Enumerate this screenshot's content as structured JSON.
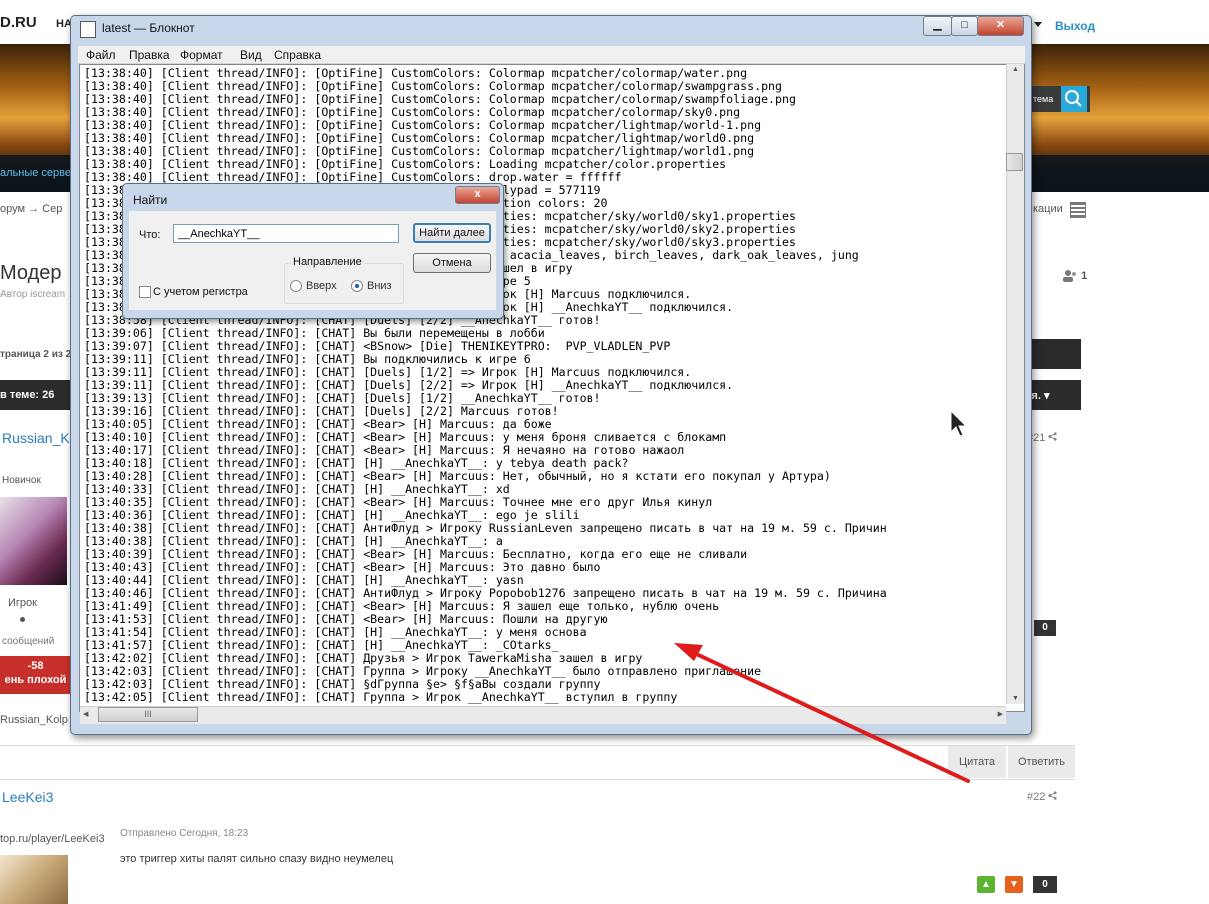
{
  "forum": {
    "logo": "D.RU",
    "nav": "НА",
    "exit": "Выход",
    "search_label": "тема",
    "servers": "альные серве",
    "breadcrumb": "орум  →  Сер",
    "breadcrumb_right": "кации",
    "topic_title": "Модер",
    "author": "Автор iscream",
    "participants": "1",
    "pages": "траница 2 из 2",
    "in_theme": "в теме: 26",
    "dark_bar_right": "ния.",
    "post1": {
      "username": "Russian_K",
      "number": "#21",
      "rank": "Новичок",
      "group": "Игрок",
      "messages": "сообщений",
      "rep_value": "-58",
      "rep_text": "ень плохой",
      "score": "0",
      "signature": "Russian_Kolp"
    },
    "quote_label": "Цитата",
    "reply_label": "Ответить",
    "post2": {
      "username": "LeeKei3",
      "number": "#22",
      "profile_link": "top.ru/player/LeeKei3",
      "sent": "Отправлено Сегодня, 18:23",
      "text": "это триггер хиты палят сильно спазу видно неумелец",
      "score": "0"
    }
  },
  "notepad": {
    "title": "latest — Блокнот",
    "menu": [
      "Файл",
      "Правка",
      "Формат",
      "Вид",
      "Справка"
    ],
    "lines": [
      "[13:38:40] [Client thread/INFO]: [OptiFine] CustomColors: Colormap mcpatcher/colormap/water.png",
      "[13:38:40] [Client thread/INFO]: [OptiFine] CustomColors: Colormap mcpatcher/colormap/swampgrass.png",
      "[13:38:40] [Client thread/INFO]: [OptiFine] CustomColors: Colormap mcpatcher/colormap/swampfoliage.png",
      "[13:38:40] [Client thread/INFO]: [OptiFine] CustomColors: Colormap mcpatcher/colormap/sky0.png",
      "[13:38:40] [Client thread/INFO]: [OptiFine] CustomColors: Colormap mcpatcher/lightmap/world-1.png",
      "[13:38:40] [Client thread/INFO]: [OptiFine] CustomColors: Colormap mcpatcher/lightmap/world0.png",
      "[13:38:40] [Client thread/INFO]: [OptiFine] CustomColors: Colormap mcpatcher/lightmap/world1.png",
      "[13:38:40] [Client thread/INFO]: [OptiFine] CustomColors: Loading mcpatcher/color.properties",
      "[13:38:40] [Client thread/INFO]: [OptiFine] CustomColors: drop.water = ffffff",
      "[13:38:40] [Client thread/INFO]: [OptiFine] CustomColors: lilypad = 577119",
      "[13:38:40] [Client thread/INFO]: [OptiFine] CustomColors: Potion colors: 20",
      "[13:38:40] [Client thread/INFO]: [OptiFine] CustomSky properties: mcpatcher/sky/world0/sky1.properties",
      "[13:38:40] [Client thread/INFO]: [OptiFine] CustomSky properties: mcpatcher/sky/world0/sky2.properties",
      "[13:38:40] [Client thread/INFO]: [OptiFine] CustomSky properties: mcpatcher/sky/world0/sky3.properties",
      "[13:38:41] [Client thread/INFO]: [OptiFine] Disable culling: acacia_leaves, birch_leaves, dark_oak_leaves, jung",
      "[13:38:48] [Client thread/INFO]: [CHAT] Игрок TxqqleClick зашел в игру",
      "[13:38:55] [Client thread/INFO]: [CHAT] Вы подключились к игре 5",
      "[13:38:55] [Client thread/INFO]: [CHAT] [Duels] [1/2] => Игрок [H] Marcuus подключился.",
      "[13:38:55] [Client thread/INFO]: [CHAT] [Duels] [2/2] => Игрок [H] __AnechkaYT__ подключился.",
      "[13:38:58] [Client thread/INFO]: [CHAT] [Duels] [2/2] __AnechkaYT__ готов!",
      "[13:39:06] [Client thread/INFO]: [CHAT] Вы были перемещены в лобби",
      "[13:39:07] [Client thread/INFO]: [CHAT] <BSnow> [Die] THENIKEYTPRO:  PVP_VLADLEN_PVP",
      "[13:39:11] [Client thread/INFO]: [CHAT] Вы подключились к игре 6",
      "[13:39:11] [Client thread/INFO]: [CHAT] [Duels] [1/2] => Игрок [H] Marcuus подключился.",
      "[13:39:11] [Client thread/INFO]: [CHAT] [Duels] [2/2] => Игрок [H] __AnechkaYT__ подключился.",
      "[13:39:13] [Client thread/INFO]: [CHAT] [Duels] [1/2] __AnechkaYT__ готов!",
      "[13:39:16] [Client thread/INFO]: [CHAT] [Duels] [2/2] Marcuus готов!",
      "[13:40:05] [Client thread/INFO]: [CHAT] <Bear> [H] Marcuus: да боже",
      "[13:40:10] [Client thread/INFO]: [CHAT] <Bear> [H] Marcuus: у меня броня сливается с блокамп",
      "[13:40:17] [Client thread/INFO]: [CHAT] <Bear> [H] Marcuus: Я нечаяно на готово нажаол",
      "[13:40:18] [Client thread/INFO]: [CHAT] [H] __AnechkaYT__: y tebya death pack?",
      "[13:40:28] [Client thread/INFO]: [CHAT] <Bear> [H] Marcuus: Нет, обычный, но я кстати его покупал у Артура)",
      "[13:40:33] [Client thread/INFO]: [CHAT] [H] __AnechkaYT__: xd",
      "[13:40:35] [Client thread/INFO]: [CHAT] <Bear> [H] Marcuus: Точнее мне его друг Илья кинул",
      "[13:40:36] [Client thread/INFO]: [CHAT] [H] __AnechkaYT__: ego je slili",
      "[13:40:38] [Client thread/INFO]: [CHAT] АнтиФлуд > Игроку RussianLeven запрещено писать в чат на 19 м. 59 с. Причин",
      "[13:40:38] [Client thread/INFO]: [CHAT] [H] __AnechkaYT__: a",
      "[13:40:39] [Client thread/INFO]: [CHAT] <Bear> [H] Marcuus: Бесплатно, когда его еще не сливали",
      "[13:40:43] [Client thread/INFO]: [CHAT] <Bear> [H] Marcuus: Это давно было",
      "[13:40:44] [Client thread/INFO]: [CHAT] [H] __AnechkaYT__: yasn",
      "[13:40:46] [Client thread/INFO]: [CHAT] АнтиФлуд > Игроку Popobob1276 запрещено писать в чат на 19 м. 59 с. Причина",
      "[13:41:49] [Client thread/INFO]: [CHAT] <Bear> [H] Marcuus: Я зашел еще только, нублю очень",
      "[13:41:53] [Client thread/INFO]: [CHAT] <Bear> [H] Marcuus: Пошли на другую",
      "[13:41:54] [Client thread/INFO]: [CHAT] [H] __AnechkaYT__: у меня основа",
      "[13:41:57] [Client thread/INFO]: [CHAT] [H] __AnechkaYT__: _COtarks_",
      "[13:42:02] [Client thread/INFO]: [CHAT] Друзья > Игрок TawerkaMisha зашел в игру",
      "[13:42:03] [Client thread/INFO]: [CHAT] Группа > Игроку __AnechkaYT__ было отправлено приглашение",
      "[13:42:03] [Client thread/INFO]: [CHAT] §dГруппа §e> §f§aВы создали группу",
      "[13:42:05] [Client thread/INFO]: [CHAT] Группа > Игрок __AnechkaYT__ вступил в группу"
    ],
    "hscroll_grip": "III"
  },
  "find_dialog": {
    "title": "Найти",
    "what_label": "Что:",
    "search_value": "__AnechkaYT__",
    "find_next": "Найти далее",
    "cancel": "Отмена",
    "direction_label": "Направление",
    "up_label": "Вверх",
    "down_label": "Вниз",
    "match_case_label": "С учетом регистра",
    "close_glyph": "x"
  },
  "colors": {
    "annotation_arrow": "#e01b1b",
    "link": "#2a7dbd",
    "reputation_bad": "#c7302a"
  }
}
